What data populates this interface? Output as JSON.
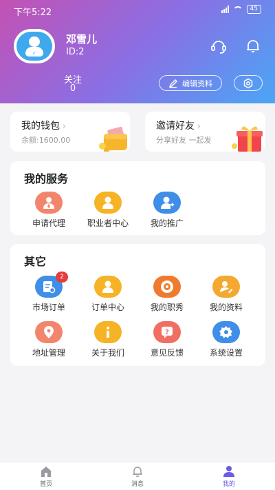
{
  "status": {
    "time": "下午5:22",
    "battery": "45"
  },
  "profile": {
    "name": "邓雪儿",
    "id": "ID:2",
    "follow_label": "关注",
    "follow_count": "0"
  },
  "header": {
    "edit_label": "编辑资料",
    "icons": [
      "headset-icon",
      "bell-icon",
      "settings-icon"
    ]
  },
  "wallet": {
    "title": "我的钱包",
    "balance": "余额:1600.00"
  },
  "invite": {
    "title": "邀请好友",
    "subtitle": "分享好友 一起发"
  },
  "services": {
    "title": "我的服务",
    "items": [
      {
        "label": "申请代理",
        "icon": "agent-icon",
        "color": "#f4856d"
      },
      {
        "label": "职业者中心",
        "icon": "person-icon",
        "color": "#f6b325"
      },
      {
        "label": "我的推广",
        "icon": "share-user-icon",
        "color": "#3f8ee8"
      }
    ]
  },
  "others": {
    "title": "其它",
    "items": [
      {
        "label": "市场订单",
        "icon": "order-search-icon",
        "color": "#3f8ee8",
        "badge": "2"
      },
      {
        "label": "订单中心",
        "icon": "person-icon",
        "color": "#f6b325"
      },
      {
        "label": "我的职秀",
        "icon": "camera-icon",
        "color": "#f07a2e"
      },
      {
        "label": "我的资料",
        "icon": "profile-edit-icon",
        "color": "#f3a930"
      },
      {
        "label": "地址管理",
        "icon": "location-icon",
        "color": "#f4856d"
      },
      {
        "label": "关于我们",
        "icon": "info-icon",
        "color": "#f6b325"
      },
      {
        "label": "意见反馈",
        "icon": "feedback-icon",
        "color": "#f06f62"
      },
      {
        "label": "系统设置",
        "icon": "gear-icon",
        "color": "#3f8ee8"
      }
    ]
  },
  "tabs": [
    {
      "label": "首页",
      "icon": "home-icon"
    },
    {
      "label": "消息",
      "icon": "bell-icon"
    },
    {
      "label": "我的",
      "icon": "user-icon",
      "active": true
    }
  ]
}
